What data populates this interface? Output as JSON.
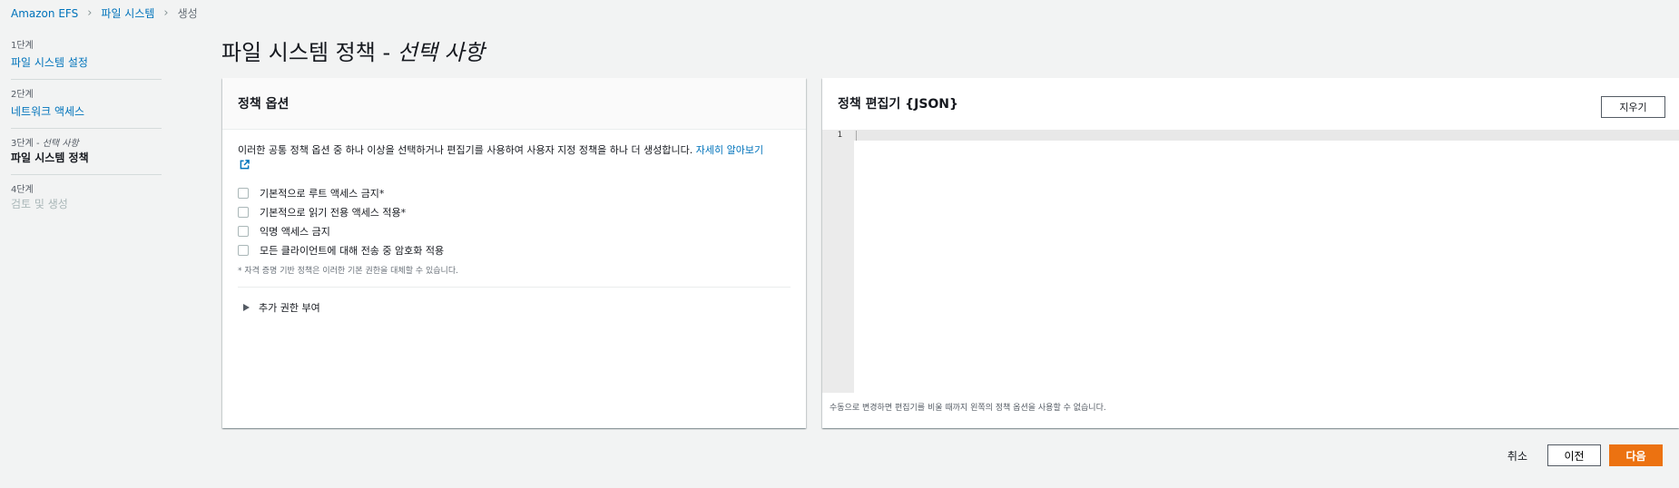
{
  "breadcrumb": {
    "items": [
      "Amazon EFS",
      "파일 시스템"
    ],
    "current": "생성"
  },
  "steps": [
    {
      "num": "1단계",
      "label": "파일 시스템 설정"
    },
    {
      "num": "2단계",
      "label": "네트워크 액세스"
    },
    {
      "num_prefix": "3단계 - ",
      "num_italic": "선택 사항",
      "label": "파일 시스템 정책"
    },
    {
      "num": "4단계",
      "label": "검토 및 생성"
    }
  ],
  "title": {
    "main": "파일 시스템 정책 - ",
    "italic": "선택 사항"
  },
  "options_panel": {
    "header": "정책 옵션",
    "description": "이러한 공통 정책 옵션 중 하나 이상을 선택하거나 편집기를 사용하여 사용자 지정 정책을 하나 더 생성합니다.",
    "learn_more": "자세히 알아보기",
    "checkboxes": [
      "기본적으로 루트 액세스 금지*",
      "기본적으로 읽기 전용 액세스 적용*",
      "익명 액세스 금지",
      "모든 클라이언트에 대해 전송 중 암호화 적용"
    ],
    "note": "* 자격 증명 기반 정책은 이러한 기본 권한을 대체할 수 있습니다.",
    "expander": "추가 권한 부여"
  },
  "editor_panel": {
    "header": "정책 편집기 {JSON}",
    "clear_button": "지우기",
    "line_number": "1",
    "footer": "수동으로 변경하면 편집기를 비울 때까지 왼쪽의 정책 옵션을 사용할 수 없습니다."
  },
  "actions": {
    "cancel": "취소",
    "previous": "이전",
    "next": "다음"
  },
  "colors": {
    "primary": "#ec7211",
    "link": "#0073bb"
  }
}
